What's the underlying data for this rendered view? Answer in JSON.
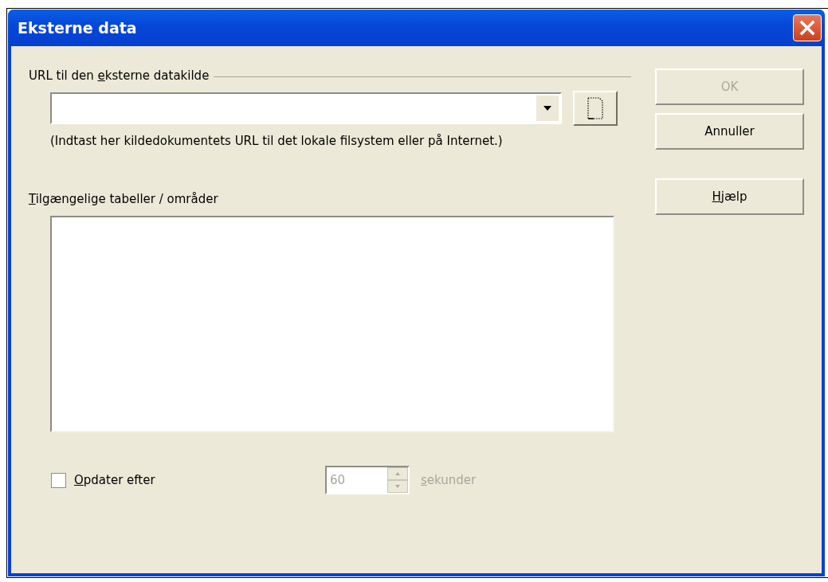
{
  "window": {
    "title": "Eksterne data"
  },
  "source": {
    "legend": [
      {
        "text": "URL til den ",
        "underline": false
      },
      {
        "text": "e",
        "underline": true
      },
      {
        "text": "ksterne datakilde",
        "underline": false
      }
    ],
    "hint": "(Indtast her kildedokumentets URL til det lokale filsystem eller på Internet.)"
  },
  "tables": {
    "label": [
      {
        "text": "T",
        "underline": true
      },
      {
        "text": "ilgængelige tabeller / områder",
        "underline": false
      }
    ]
  },
  "refresh": {
    "checked": false,
    "label": [
      {
        "text": "O",
        "underline": true
      },
      {
        "text": "pdater efter",
        "underline": false
      }
    ],
    "interval": "60",
    "disabled": true,
    "unit": [
      {
        "text": "s",
        "underline": true
      },
      {
        "text": "ekunder",
        "underline": false
      }
    ]
  },
  "buttons": [
    {
      "label": [
        {
          "text": "OK",
          "underline": false
        }
      ],
      "disabled": true
    },
    {
      "label": [
        {
          "text": "Annuller",
          "underline": false
        }
      ],
      "disabled": false
    },
    {
      "label": [
        {
          "text": "H",
          "underline": true
        },
        {
          "text": "jælp",
          "underline": false
        }
      ],
      "disabled": false
    }
  ]
}
